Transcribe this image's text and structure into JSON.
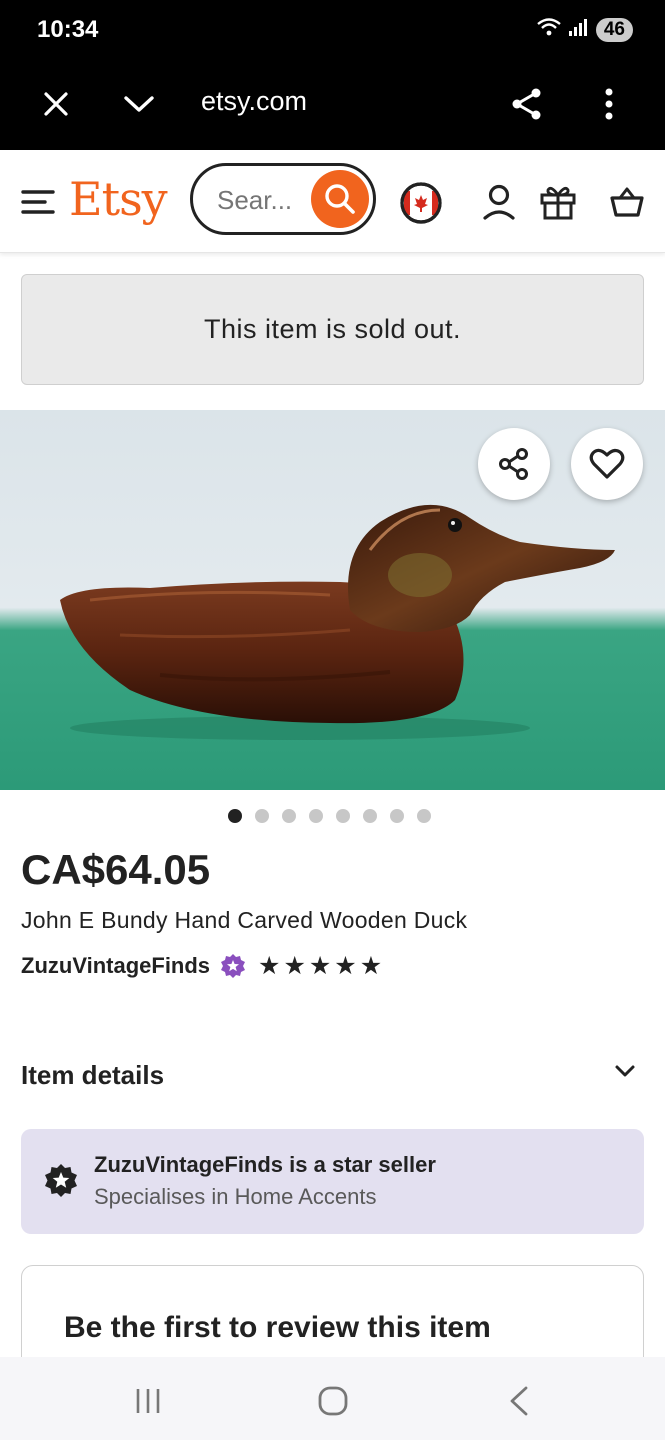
{
  "status_bar": {
    "time": "10:34",
    "battery": "46",
    "wifi_icon": "wifi-icon",
    "signal_icon": "signal-icon"
  },
  "browser": {
    "url": "etsy.com"
  },
  "header": {
    "logo": "Etsy",
    "search_placeholder": "Sear...",
    "icons": [
      "menu-icon",
      "search-icon",
      "canada-flag-icon",
      "account-icon",
      "gift-icon",
      "cart-icon"
    ]
  },
  "notice": {
    "sold_out": "This item is sold out."
  },
  "gallery": {
    "image_count": 8,
    "active_index": 0
  },
  "product": {
    "price": "CA$64.05",
    "title": "John E Bundy Hand Carved Wooden Duck",
    "shop_name": "ZuzuVintageFinds",
    "stars": "★★★★★",
    "rating": 5
  },
  "item_details": {
    "label": "Item details"
  },
  "star_seller": {
    "title": "ZuzuVintageFinds is a star seller",
    "subtitle": "Specialises in Home Accents"
  },
  "reviews": {
    "title": "Be the first to review this item"
  },
  "colors": {
    "brand": "#f1641e",
    "star_seller_bg": "#e3e0f0",
    "badge": "#8a4fbe"
  }
}
